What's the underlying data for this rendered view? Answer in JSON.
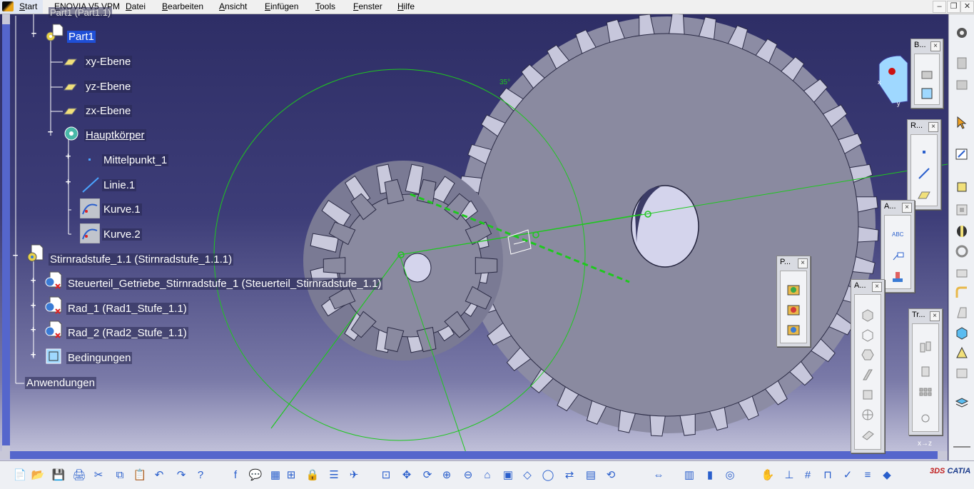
{
  "menubar": {
    "start": "Start",
    "items": [
      "ENOVIA V5 VPM",
      "Datei",
      "Bearbeiten",
      "Ansicht",
      "Einfügen",
      "Tools",
      "Fenster",
      "Hilfe"
    ]
  },
  "tree": {
    "partial_top": "Part1 (Part1.1)",
    "part": "Part1",
    "planes": [
      "xy-Ebene",
      "yz-Ebene",
      "zx-Ebene"
    ],
    "body": "Hauptkörper",
    "body_children": [
      "Mittelpunkt_1",
      "Linie.1",
      "Kurve.1",
      "Kurve.2"
    ],
    "product": "Stirnradstufe_1.1 (Stirnradstufe_1.1.1)",
    "product_children": [
      "Steuerteil_Getriebe_Stirnradstufe_1 (Steuerteil_Stirnradstufe_1.1)",
      "Rad_1 (Rad1_Stufe_1.1)",
      "Rad_2 (Rad2_Stufe_1.1)",
      "Bedingungen"
    ],
    "applications": "Anwendungen"
  },
  "viewport": {
    "angle_label": "35°"
  },
  "palettes": {
    "b": {
      "title": "B..."
    },
    "r": {
      "title": "R..."
    },
    "a1": {
      "title": "A..."
    },
    "p": {
      "title": "P..."
    },
    "a2": {
      "title": "A..."
    },
    "tr": {
      "title": "Tr..."
    }
  },
  "axis": {
    "label": "x→z"
  },
  "compass_axis": {
    "x": "x",
    "y": "y"
  },
  "logo": {
    "text": "CATIA",
    "mark": "3DS"
  },
  "colors": {
    "background_top": "#2e2e66",
    "background_bottom": "#c9c9df",
    "gear": "#8a8aa0",
    "selection": "#1f4fd6",
    "sketch": "#1ec81e"
  },
  "icons": {
    "bottom_toolbar": [
      "new-file",
      "open-folder",
      "save",
      "print",
      "cut",
      "copy",
      "paste",
      "undo",
      "redo",
      "whats-this",
      "formula",
      "comment",
      "table",
      "product-structure",
      "lock",
      "tree-list",
      "fly",
      "fit-all",
      "pan",
      "rotate",
      "zoom-in",
      "zoom-out",
      "normal-view",
      "multi-view",
      "iso-view",
      "hide-show",
      "swap-space",
      "render-style",
      "update",
      "measure",
      "catalog",
      "mass",
      "spin",
      "hand",
      "axis-system",
      "numeric",
      "cylinder",
      "check",
      "list",
      "eraser"
    ],
    "right_toolbar": [
      "gear",
      "product",
      "assembly",
      "select",
      "sketch",
      "pad",
      "pocket",
      "shaft",
      "edge-fillet",
      "draft",
      "shell",
      "thickness",
      "rib",
      "measure",
      "hole"
    ]
  }
}
